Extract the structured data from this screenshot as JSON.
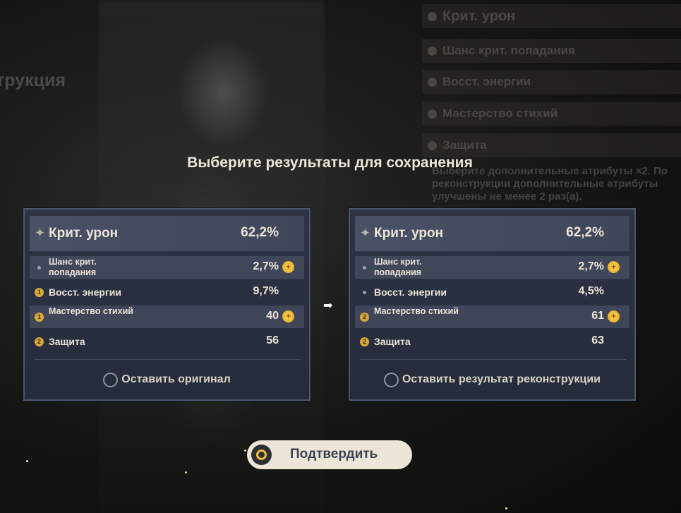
{
  "background": {
    "left_text": "трукция",
    "right_rows": [
      {
        "label": "Крит. урон",
        "big": true
      },
      {
        "label": "Шанс крит. попадания",
        "big": false
      },
      {
        "label": "Восст. энергии",
        "big": false
      },
      {
        "label": "Мастерство стихий",
        "big": false
      },
      {
        "label": "Защита",
        "big": false
      }
    ],
    "right_desc": "Выберите дополнительные атрибуты ×2. По реконструкции дополнительные атрибуты улучшены не менее 2 раз(а)."
  },
  "dialog": {
    "title": "Выберите результаты для сохранения",
    "original": {
      "main": {
        "label": "Крит. урон",
        "value": "62,2%"
      },
      "subs": [
        {
          "label": "Шанс крит. попадания",
          "value": "2,7%",
          "marker": "dot",
          "marker_text": "",
          "upgraded": true,
          "two_line": true
        },
        {
          "label": "Восст. энергии",
          "value": "9,7%",
          "marker": "num",
          "marker_text": "1",
          "upgraded": false,
          "two_line": false
        },
        {
          "label": "Мастерство стихий",
          "value": "40",
          "marker": "num",
          "marker_text": "1",
          "upgraded": true,
          "two_line": true
        },
        {
          "label": "Защита",
          "value": "56",
          "marker": "num",
          "marker_text": "2",
          "upgraded": false,
          "two_line": false
        }
      ],
      "keep_label": "Оставить оригинал"
    },
    "result": {
      "main": {
        "label": "Крит. урон",
        "value": "62,2%"
      },
      "subs": [
        {
          "label": "Шанс крит. попадания",
          "value": "2,7%",
          "marker": "dot",
          "marker_text": "",
          "upgraded": true,
          "two_line": true
        },
        {
          "label": "Восст. энергии",
          "value": "4,5%",
          "marker": "dot",
          "marker_text": "",
          "upgraded": false,
          "two_line": false
        },
        {
          "label": "Мастерство стихий",
          "value": "61",
          "marker": "num",
          "marker_text": "2",
          "upgraded": true,
          "two_line": true
        },
        {
          "label": "Защита",
          "value": "63",
          "marker": "num",
          "marker_text": "2",
          "upgraded": false,
          "two_line": false
        }
      ],
      "keep_label": "Оставить результат реконструкции"
    },
    "arrow_icon": "arrow-right-icon",
    "confirm_label": "Подтвердить"
  },
  "colors": {
    "accent_gold": "#d9a93c",
    "card_bg": "#2e3446",
    "button_bg": "#ece5d8"
  }
}
